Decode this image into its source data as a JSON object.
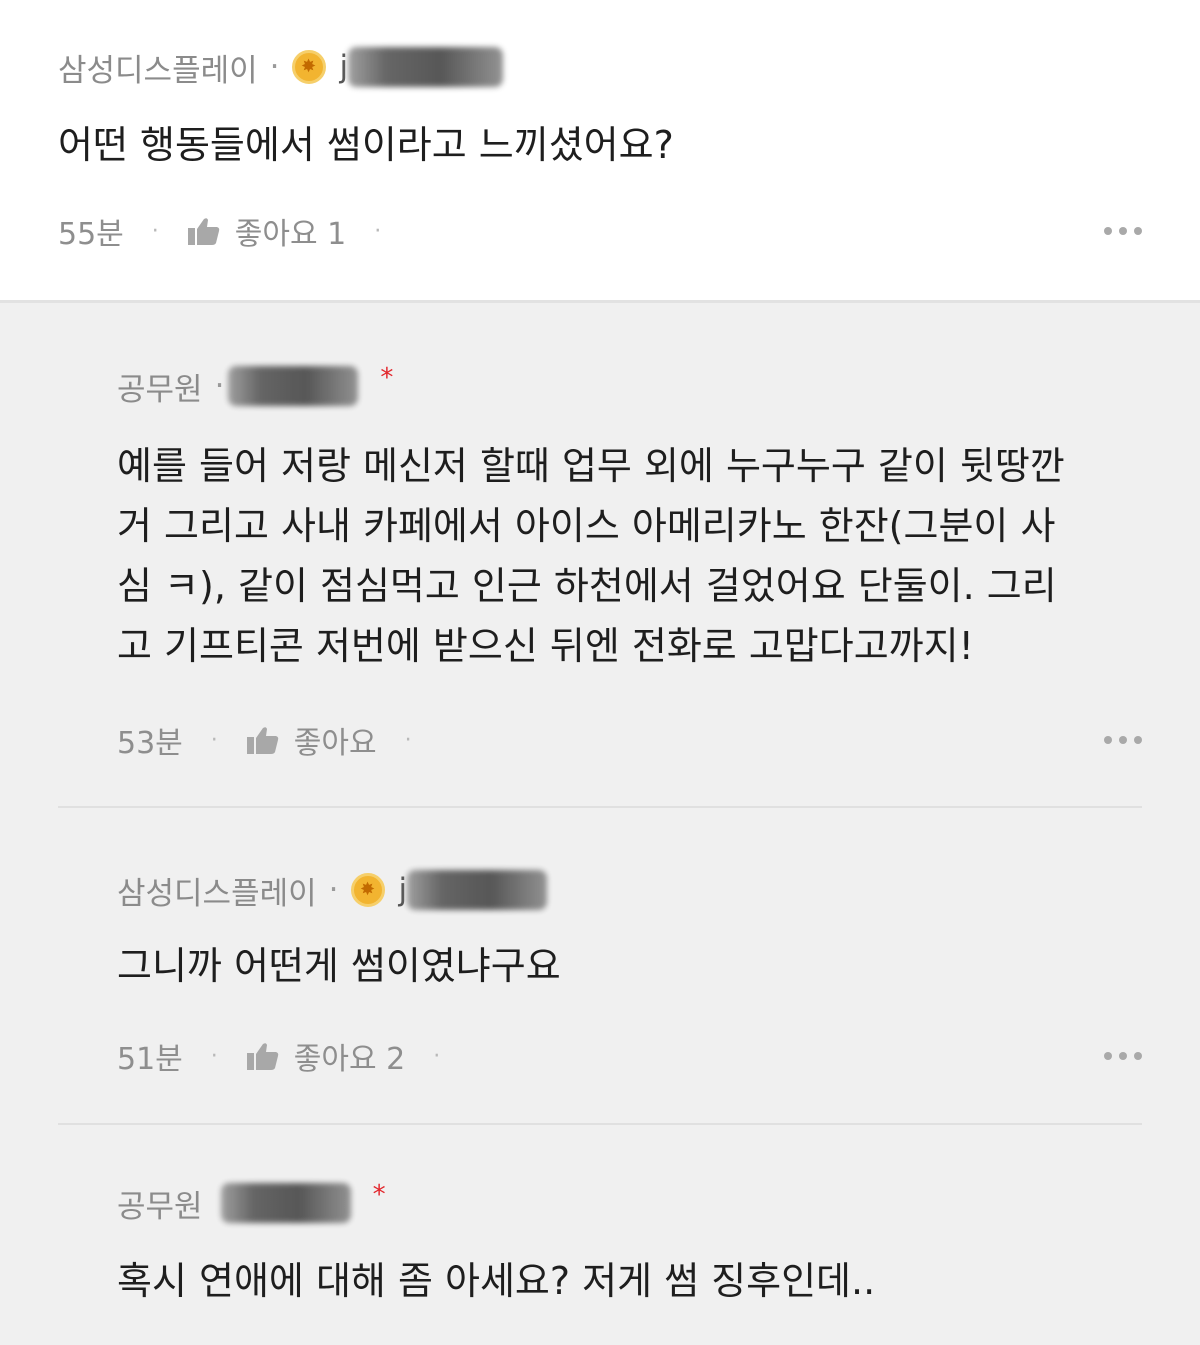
{
  "top_comment": {
    "company": "삼성디스플레이",
    "meta_dot": "·",
    "username_fragment": "j",
    "text": "어떤 행동들에서 썸이라고 느끼셨어요?",
    "time": "55분",
    "like_label": "좋아요 1"
  },
  "replies": [
    {
      "company": "공무원",
      "meta_dot": "·",
      "star": "*",
      "text_lines": [
        "예를 들어 저랑 메신저 할때 업무 외에 누구누구 같이 뒷땅깐",
        "거 그리고 사내 카페에서 아이스 아메리카노 한잔(그분이 사",
        "심 ㅋ), 같이 점심먹고 인근 하천에서 걸었어요 단둘이. 그리",
        "고 기프티콘 저번에 받으신 뒤엔 전화로 고맙다고까지!"
      ],
      "time": "53분",
      "like_label": "좋아요"
    },
    {
      "company": "삼성디스플레이",
      "meta_dot": "·",
      "username_fragment": "j",
      "text_lines": [
        "그니까 어떤게 썸이였냐구요"
      ],
      "time": "51분",
      "like_label": "좋아요 2"
    },
    {
      "company": "공무원",
      "star": "*",
      "text_lines": [
        "혹시 연애에 대해 좀 아세요? 저게 썸 징후인데.."
      ]
    }
  ],
  "colors": {
    "badge": "#f2b430",
    "star": "#e2262c",
    "reply_background": "#f0f0f0",
    "meta_text": "#8b8b8b"
  },
  "icons": {
    "like": "thumbs-up-icon",
    "more": "more-dots-icon",
    "badge": "company-badge-icon"
  }
}
